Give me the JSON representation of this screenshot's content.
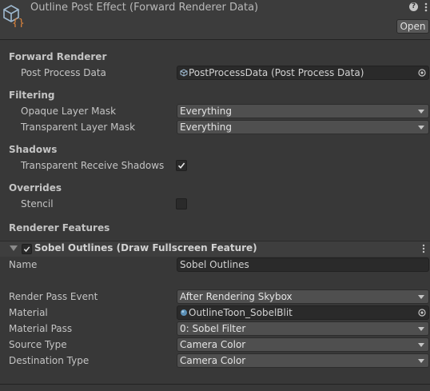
{
  "header": {
    "title": "Outline Post Effect (Forward Renderer Data)",
    "help_glyph": "?",
    "open_label": "Open"
  },
  "forward_renderer": {
    "heading": "Forward Renderer",
    "post_process_label": "Post Process Data",
    "post_process_value": "PostProcessData (Post Process Data)"
  },
  "filtering": {
    "heading": "Filtering",
    "opaque_label": "Opaque Layer Mask",
    "opaque_value": "Everything",
    "transparent_label": "Transparent Layer Mask",
    "transparent_value": "Everything"
  },
  "shadows": {
    "heading": "Shadows",
    "receive_label": "Transparent Receive Shadows",
    "receive_checked": true
  },
  "overrides": {
    "heading": "Overrides",
    "stencil_label": "Stencil",
    "stencil_checked": false
  },
  "renderer_features": {
    "heading": "Renderer Features",
    "feature": {
      "title": "Sobel Outlines (Draw Fullscreen Feature)",
      "enabled": true,
      "name_label": "Name",
      "name_value": "Sobel Outlines",
      "render_pass_event_label": "Render Pass Event",
      "render_pass_event_value": "After Rendering Skybox",
      "material_label": "Material",
      "material_value": "OutlineToon_SobelBlit",
      "material_pass_label": "Material Pass",
      "material_pass_value": "0: Sobel Filter",
      "source_type_label": "Source Type",
      "source_type_value": "Camera Color",
      "destination_type_label": "Destination Type",
      "destination_type_value": "Camera Color"
    }
  },
  "colors": {
    "background": "#383838",
    "field": "#2a2a2a",
    "dropdown": "#4f4f4f",
    "text": "#c4c4c4"
  },
  "icons": [
    "scriptable-object-icon",
    "help-icon",
    "kebab-menu-icon",
    "checkmark-icon",
    "object-picker-icon",
    "material-sphere-icon",
    "dropdown-arrow-icon",
    "foldout-arrow-icon"
  ]
}
